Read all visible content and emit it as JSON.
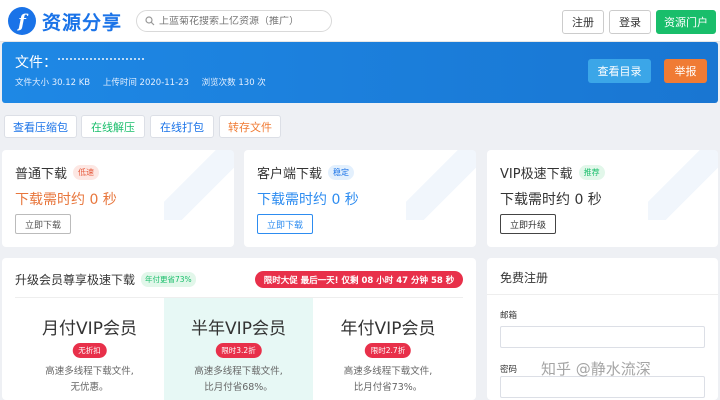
{
  "header": {
    "logo_mark": "f",
    "logo_text": "资源分享",
    "search_placeholder": "上蓝菊花搜索上亿资源（推广）",
    "register_label": "注册",
    "login_label": "登录",
    "portal_label": "资源门户"
  },
  "file": {
    "label": "文件：",
    "size": "文件大小 30.12 KB",
    "upload": "上传时间 2020-11-23",
    "views": "浏览次数 130 次",
    "view_dir_label": "查看目录",
    "report_label": "举报"
  },
  "actions": {
    "view_zip": "查看压缩包",
    "online_unzip": "在线解压",
    "online_pack": "在线打包",
    "transfer": "转存文件"
  },
  "downloads": [
    {
      "title": "普通下载",
      "tag": "低速",
      "time": "下载需时约 0 秒",
      "button": "立即下载"
    },
    {
      "title": "客户端下载",
      "tag": "稳定",
      "time": "下载需时约 0 秒",
      "button": "立即下载"
    },
    {
      "title": "VIP极速下载",
      "tag": "推荐",
      "time": "下载需时约 0 秒",
      "button": "立即升级"
    }
  ],
  "vip": {
    "title": "升级会员尊享极速下载",
    "tag": "年付更省73%",
    "promo": "限时大促 最后一天! 仅剩 08 小时 47 分钟 58 秒",
    "plans": [
      {
        "name": "月付VIP会员",
        "badge": "无折扣",
        "desc1": "高速多线程下载文件,",
        "desc2": "无优惠。"
      },
      {
        "name": "半年VIP会员",
        "badge": "限时3.2折",
        "desc1": "高速多线程下载文件,",
        "desc2": "比月付省68%。"
      },
      {
        "name": "年付VIP会员",
        "badge": "限时2.7折",
        "desc1": "高速多线程下载文件,",
        "desc2": "比月付省73%。"
      }
    ]
  },
  "register": {
    "title": "免费注册",
    "email_label": "邮箱",
    "password_label": "密码"
  },
  "watermark": "知乎 @静水流深"
}
